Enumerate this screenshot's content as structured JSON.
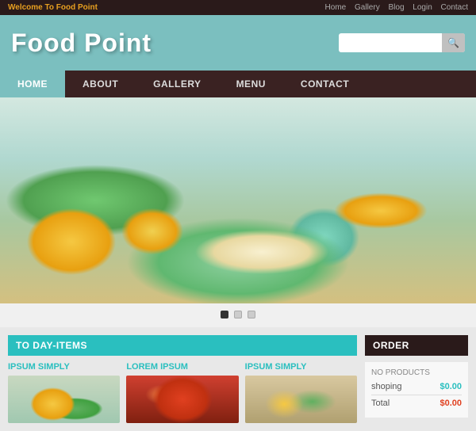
{
  "topbar": {
    "welcome_text": "Welcome To ",
    "brand": "Food Point",
    "links": [
      "Home",
      "Gallery",
      "Blog",
      "Login",
      "Contact"
    ]
  },
  "header": {
    "logo": "Food Point",
    "search_placeholder": ""
  },
  "nav": {
    "items": [
      {
        "label": "HOME",
        "active": true
      },
      {
        "label": "ABOUT",
        "active": false
      },
      {
        "label": "GALLERY",
        "active": false
      },
      {
        "label": "MENU",
        "active": false
      },
      {
        "label": "CONTACT",
        "active": false
      }
    ]
  },
  "carousel": {
    "dots": [
      {
        "active": true
      },
      {
        "active": false
      },
      {
        "active": false
      }
    ]
  },
  "today_items": {
    "header": "TO DAY-ITEMS",
    "items": [
      {
        "title": "IPSUM SIMPLY",
        "img_class": "item-img-1"
      },
      {
        "title": "LOREM IPSUM",
        "img_class": "item-img-2"
      },
      {
        "title": "IPSUM SIMPLY",
        "img_class": "item-img-3"
      }
    ]
  },
  "order": {
    "header": "ORDER",
    "no_products": "NO PRODUCTS",
    "shopping_label": "shoping",
    "shopping_value": "$0.00",
    "total_label": "Total",
    "total_value": "$0.00"
  },
  "search": {
    "button_icon": "🔍"
  }
}
